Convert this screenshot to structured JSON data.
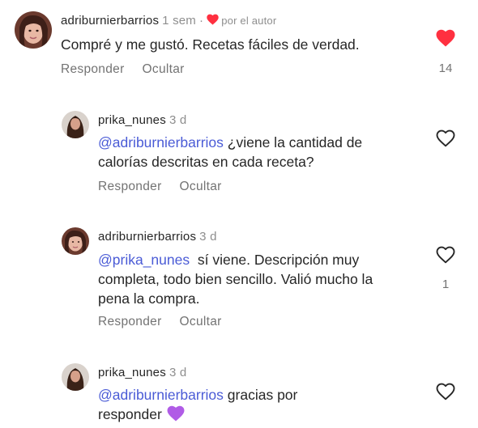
{
  "comments": [
    {
      "username": "adriburnierbarrios",
      "time": "1 sem",
      "author_liked_label": "por el autor",
      "text": "Compré y me gustó. Recetas fáciles de verdad.",
      "reply_label": "Responder",
      "hide_label": "Ocultar",
      "like_count": "14",
      "liked": true
    },
    {
      "username": "prika_nunes",
      "time": "3 d",
      "mention": "@adriburnierbarrios",
      "text": "¿viene la cantidad de calorías descritas en cada receta?",
      "reply_label": "Responder",
      "hide_label": "Ocultar",
      "liked": false
    },
    {
      "username": "adriburnierbarrios",
      "time": "3 d",
      "mention": "@prika_nunes",
      "text": "sí viene. Descripción muy completa, todo bien sencillo. Valió mucho la pena la compra.",
      "reply_label": "Responder",
      "hide_label": "Ocultar",
      "like_count": "1",
      "liked": false
    },
    {
      "username": "prika_nunes",
      "time": "3 d",
      "mention": "@adriburnierbarrios",
      "text": "gracias por responder",
      "liked": false
    }
  ],
  "icons": {
    "like": "heart-outline-icon",
    "liked": "heart-filled-icon",
    "emoji": "purple-heart-emoji"
  },
  "colors": {
    "liked_red": "#ff3040",
    "mention_blue": "#4a5bd6",
    "secondary_gray": "#737373",
    "emoji_purple": "#b05ce6"
  }
}
